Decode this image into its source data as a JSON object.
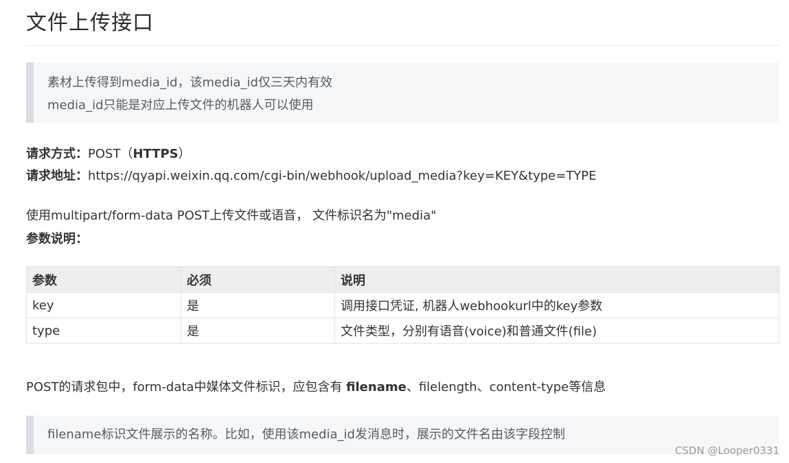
{
  "title": "文件上传接口",
  "note1": {
    "line1": "素材上传得到media_id，该media_id仅三天内有效",
    "line2": "media_id只能是对应上传文件的机器人可以使用"
  },
  "request": {
    "method_label": "请求方式：",
    "method_value": "POST（",
    "method_bold": "HTTPS",
    "method_close": "）",
    "url_label": "请求地址：",
    "url_value": "https://qyapi.weixin.qq.com/cgi-bin/webhook/upload_media?key=KEY&type=TYPE"
  },
  "usage": "使用multipart/form-data POST上传文件或语音， 文件标识名为\"media\"",
  "params_label": "参数说明：",
  "table": {
    "headers": [
      "参数",
      "必须",
      "说明"
    ],
    "rows": [
      [
        "key",
        "是",
        "调用接口凭证, 机器人webhookurl中的key参数"
      ],
      [
        "type",
        "是",
        "文件类型，分别有语音(voice)和普通文件(file)"
      ]
    ]
  },
  "post_info": {
    "before": "POST的请求包中，form-data中媒体文件标识，应包含有 ",
    "bold": "filename",
    "after": "、filelength、content-type等信息"
  },
  "note2": {
    "line1": "filename标识文件展示的名称。比如，使用该media_id发消息时，展示的文件名由该字段控制"
  },
  "watermark": "CSDN @Looper0331"
}
